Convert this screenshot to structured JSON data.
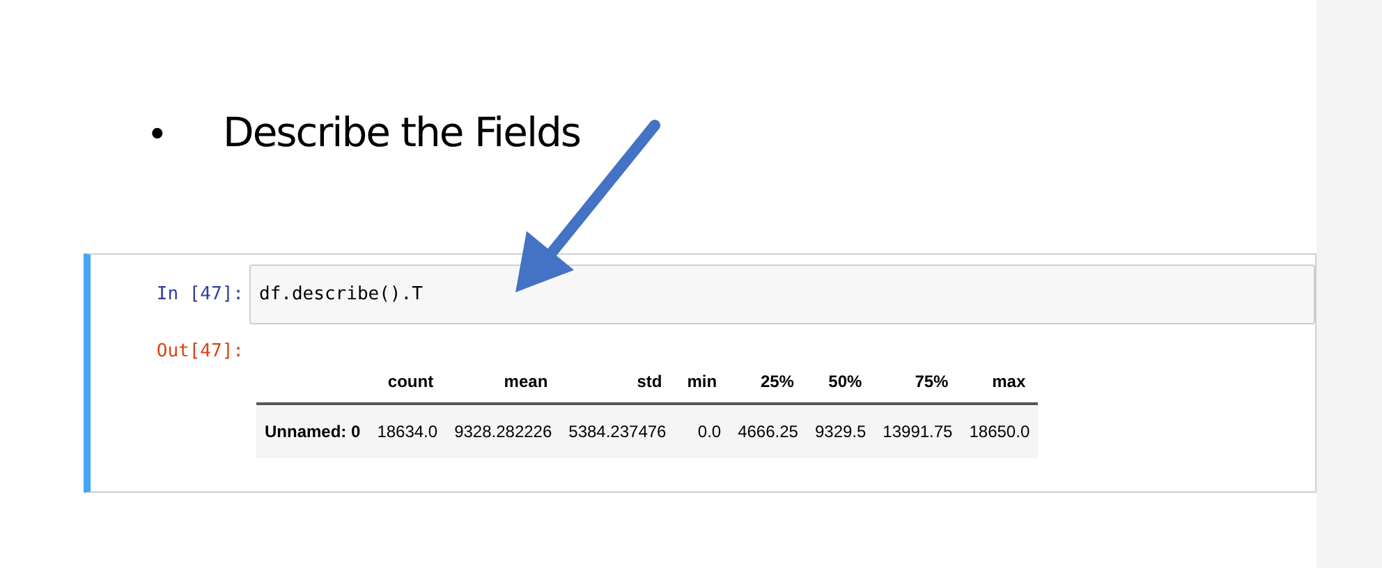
{
  "slide": {
    "bullet": "•",
    "heading": "Describe the Fields"
  },
  "cell": {
    "in_prompt": "In [47]:",
    "code": "df.describe().T",
    "out_prompt": "Out[47]:"
  },
  "table": {
    "columns": [
      "count",
      "mean",
      "std",
      "min",
      "25%",
      "50%",
      "75%",
      "max"
    ],
    "rows": [
      {
        "index": "Unnamed: 0",
        "cells": [
          "18634.0",
          "9328.282226",
          "5384.237476",
          "0.0",
          "4666.25",
          "9329.5",
          "13991.75",
          "18650.0"
        ]
      }
    ]
  }
}
